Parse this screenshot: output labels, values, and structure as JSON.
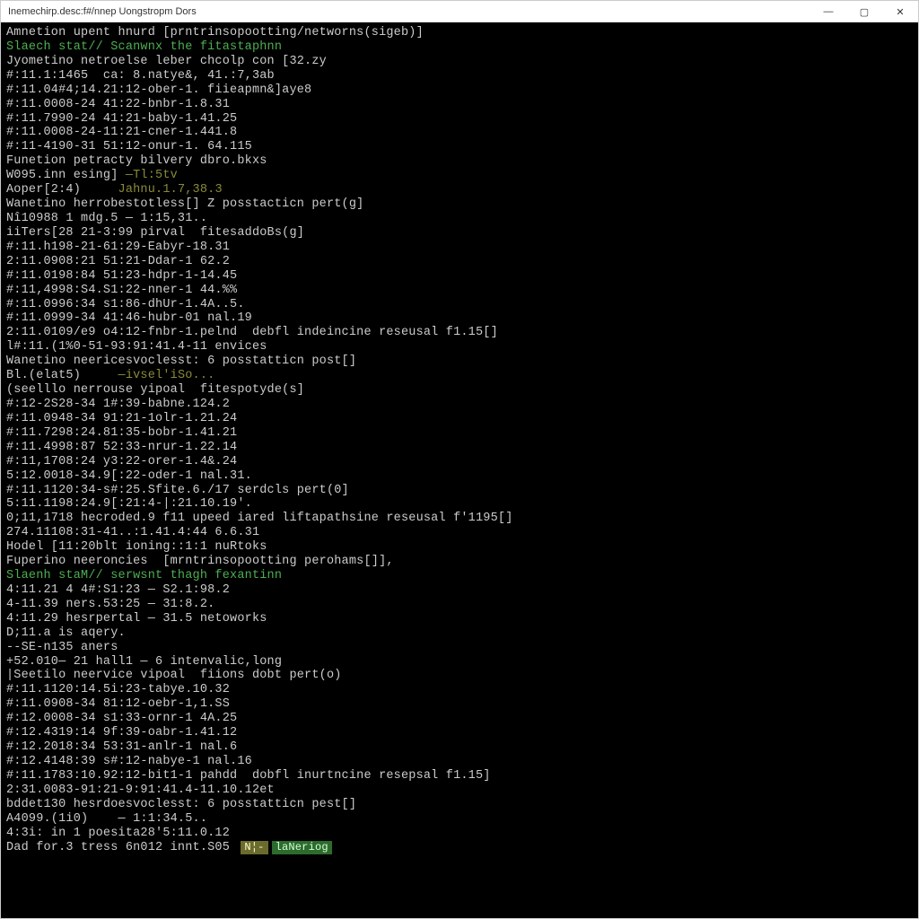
{
  "titlebar": {
    "title": "Inemechirp.desc:f#/nnep Uongstropm Dors",
    "minimize": "—",
    "maximize": "▢",
    "close": "✕"
  },
  "terminal": {
    "lines": [
      {
        "t": "Amnetion upent hnurd [prntrinsopootting/networns(sigeb)]",
        "cls": ""
      },
      {
        "t": "",
        "cls": ""
      },
      {
        "t": "Slaech stat// Scanwnx the fitastaphnn",
        "cls": "green"
      },
      {
        "t": "Jyometino netroelse leber chcolp con [32.zy",
        "cls": ""
      },
      {
        "t": "#:11.1:1465  ca: 8.natye&, 41.:7,3ab",
        "cls": ""
      },
      {
        "t": "#:11.04#4;14.21:12-ober-1. fiieapmn&]aye8",
        "cls": ""
      },
      {
        "t": "#:11.0008-24 41:22-bnbr-1.8.31",
        "cls": ""
      },
      {
        "t": "#:11.7990-24 41:21-baby-1.41.25",
        "cls": ""
      },
      {
        "t": "#:11.0008-24-11:21-cner-1.441.8",
        "cls": ""
      },
      {
        "t": "#:11-4190-31 51:12-onur-1. 64.115",
        "cls": ""
      },
      {
        "t": "Funetion petracty bilvery dbro.bkxs",
        "cls": ""
      },
      {
        "t": "W095.inn esing] —Tl:5tv",
        "cls": "",
        "suffix_cls": "olive",
        "prefix": "W095.inn esing] ",
        "suffix": "—Tl:5tv"
      },
      {
        "t": "Aoper[2:4)     Jahnu.1.7,38.3",
        "cls": "",
        "prefix": "Aoper[2:4)     ",
        "suffix": "Jahnu.1.7,38.3",
        "suffix_cls": "olive"
      },
      {
        "t": "Wanetino herrobestotless[] Z posstacticn pert(g]",
        "cls": ""
      },
      {
        "t": "Nî10988 1 mdg.5 — 1:15,31..",
        "cls": ""
      },
      {
        "t": "iiTers[28 21-3:99 pirval  fitesaddoBs(g]",
        "cls": ""
      },
      {
        "t": "#:11.h198-21-61:29-Eabyr-18.31",
        "cls": ""
      },
      {
        "t": "2:11.0908:21 51:21-Ddar-1 62.2",
        "cls": ""
      },
      {
        "t": "#:11.0198:84 51:23-hdpr-1-14.45",
        "cls": ""
      },
      {
        "t": "#:11,4998:S4.S1:22-nner-1 44.%%",
        "cls": ""
      },
      {
        "t": "#:11.0996:34 s1:86-dhUr-1.4A..5.",
        "cls": ""
      },
      {
        "t": "#:11.0999-34 41:46-hubr-01 nal.19",
        "cls": ""
      },
      {
        "t": "2:11.0109/e9 o4:12-fnbr-1.pelnd  debfl indeincine reseusal f1.15[]",
        "cls": ""
      },
      {
        "t": "l#:11.(1%0-51-93:91:41.4-11 envices",
        "cls": ""
      },
      {
        "t": "Wanetino neericesvoclesst: 6 posstatticn post[]",
        "cls": ""
      },
      {
        "t": "Bl.(elat5)     —ivsel'iSo...",
        "cls": "",
        "prefix": "Bl.(elat5)     ",
        "suffix": "—ivsel'iSo...",
        "suffix_cls": "olive"
      },
      {
        "t": "(seelllo nerrouse yipoal  fitespotyde(s]",
        "cls": ""
      },
      {
        "t": "#:12-2S28-34 1#:39-babne.124.2",
        "cls": ""
      },
      {
        "t": "#:11.0948-34 91:21-1olr-1.21.24",
        "cls": ""
      },
      {
        "t": "#:11.7298:24.81:35-bobr-1.41.21",
        "cls": ""
      },
      {
        "t": "#:11.4998:87 52:33-nrur-1.22.14",
        "cls": ""
      },
      {
        "t": "#:11,1708:24 y3:22-orer-1.4&.24",
        "cls": ""
      },
      {
        "t": "5:12.0018-34.9[:22-oder-1 nal.31.",
        "cls": ""
      },
      {
        "t": "#:11.1120:34-s#:25.Sfite.6./17 serdcls pert(0]",
        "cls": ""
      },
      {
        "t": "5:11.1198:24.9[:21:4-|:21.10.19'.",
        "cls": ""
      },
      {
        "t": "0;11,1718 hecroded.9 f11 upeed iared liftapathsine reseusal f'1195[]",
        "cls": ""
      },
      {
        "t": "274.11108:31-41..:1.41.4:44 6.6.31",
        "cls": ""
      },
      {
        "t": "Hodel [11:20blt ioning::1:1 nuRtoks",
        "cls": ""
      },
      {
        "t": "Fuperino neeroncies  [mrntrinsopootting perohams[]],",
        "cls": ""
      },
      {
        "t": "",
        "cls": ""
      },
      {
        "t": "Slaenh staM// serwsnt thagh fexantinn",
        "cls": "green"
      },
      {
        "t": "4:11.21 4 4#:S1:23 — S2.1:98.2",
        "cls": ""
      },
      {
        "t": "4-11.39 ners.53:25 — 31:8.2.",
        "cls": ""
      },
      {
        "t": "4:11.29 hesrpertal — 31.5 netoworks",
        "cls": ""
      },
      {
        "t": "D;11.a is aqery.",
        "cls": ""
      },
      {
        "t": "--SE-n135 aners",
        "cls": ""
      },
      {
        "t": "+52.010— 21 hall1 — 6 intenvalic,long",
        "cls": ""
      },
      {
        "t": "|Seetilo neervice vipoal  fiions dobt pert(o)",
        "cls": ""
      },
      {
        "t": "#:11.1120:14.5i:23-tabye.10.32",
        "cls": ""
      },
      {
        "t": "#:11.0908-34 81:12-oebr-1,1.SS",
        "cls": ""
      },
      {
        "t": "#:12.0008-34 s1:33-ornr-1 4A.25",
        "cls": ""
      },
      {
        "t": "#:12.4319:14 9f:39-oabr-1.41.12",
        "cls": ""
      },
      {
        "t": "#:12.2018:34 53:31-anlr-1 nal.6",
        "cls": ""
      },
      {
        "t": "#:12.4148:39 s#:12-nabye-1 nal.16",
        "cls": ""
      },
      {
        "t": "#:11.1783:10.92:12-bit1-1 pahdd  dobfl inurtncine resepsal f1.15]",
        "cls": ""
      },
      {
        "t": "2:31.0083-91:21-9:91:41.4-11.10.12et",
        "cls": ""
      },
      {
        "t": "bddet130 hesrdoesvoclesst: 6 posstatticn pest[]",
        "cls": ""
      },
      {
        "t": "A4099.(1i0)    — 1:1:34.5..",
        "cls": ""
      },
      {
        "t": "4:3i: in 1 poesita28'5:11.0.12",
        "cls": ""
      }
    ],
    "bottom": {
      "prefix": "Dad for.3 tress 6n012 innt.S05 ",
      "chip1": "N¦-",
      "chip2": "laNeriog"
    }
  }
}
